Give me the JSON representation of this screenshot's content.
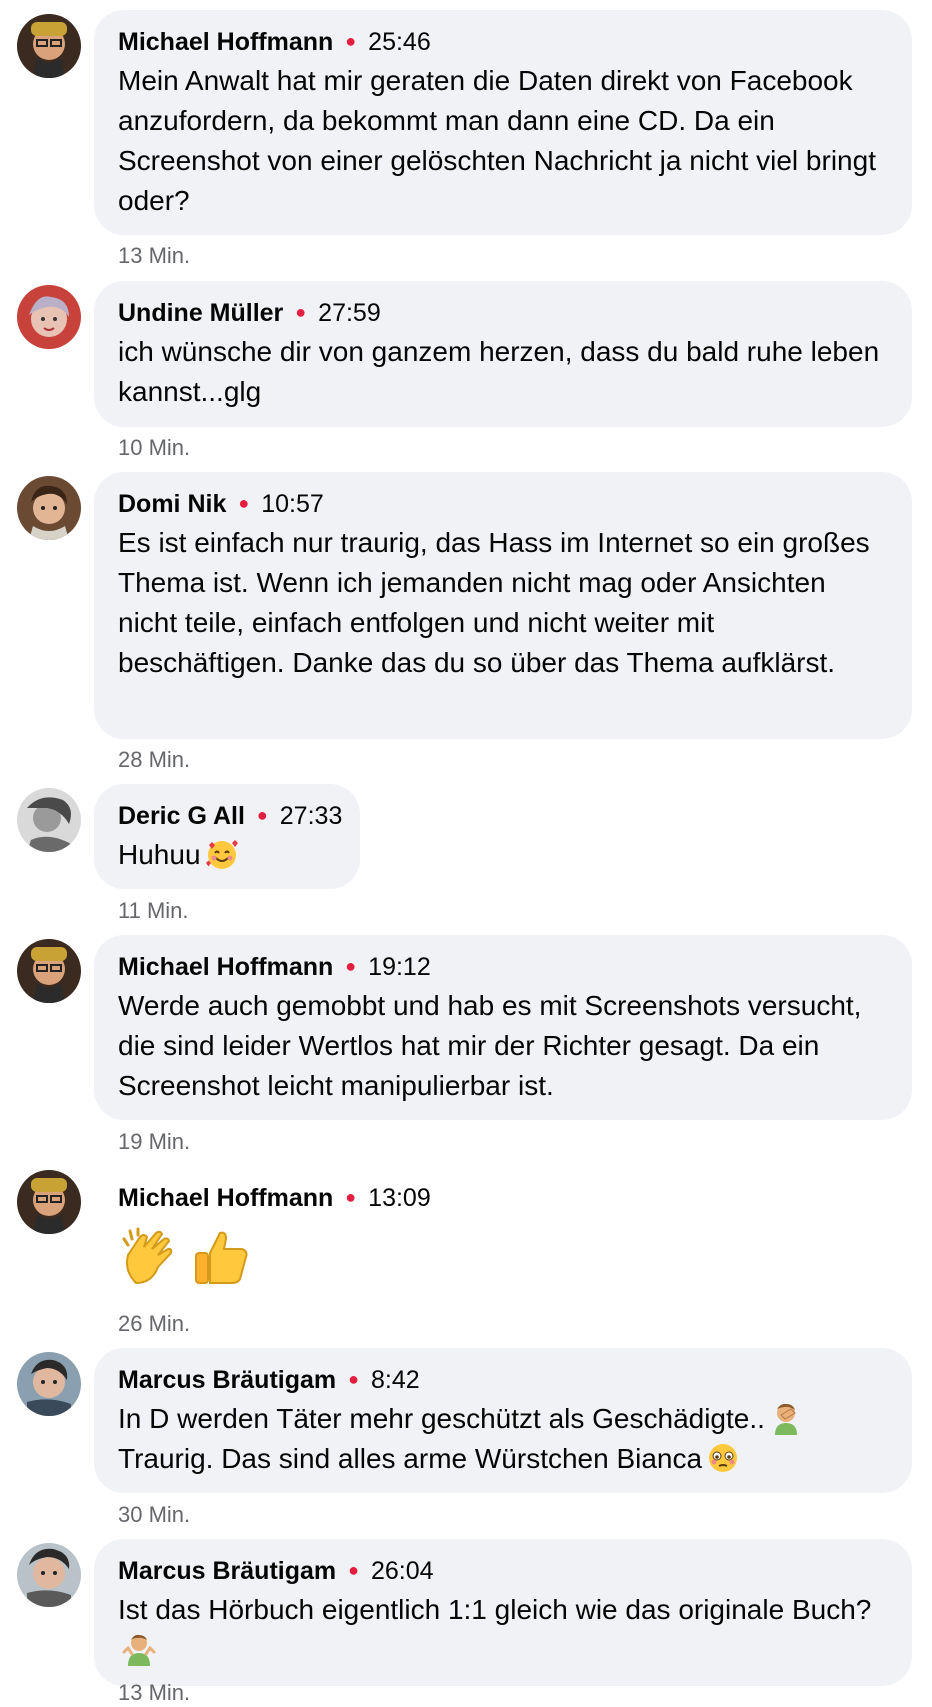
{
  "comments": [
    {
      "author": "Michael Hoffmann",
      "time": "25:46",
      "text": "Mein Anwalt hat mir geraten die Daten direkt von Facebook anzufordern, da bekommt man dann eine CD. Da ein Screenshot von einer gelöschten Nachricht ja nicht viel bringt oder?",
      "ago": "13 Min."
    },
    {
      "author": "Undine Müller",
      "time": "27:59",
      "text": "ich wünsche dir von ganzem herzen, dass du bald ruhe leben kannst...glg",
      "ago": "10 Min."
    },
    {
      "author": "Domi Nik",
      "time": "10:57",
      "text": "Es ist einfach nur traurig, das Hass im Internet so ein großes Thema ist. Wenn ich jemanden nicht mag oder Ansichten nicht teile, einfach entfolgen und nicht weiter mit beschäftigen. Danke das du so über das Thema aufklärst.",
      "ago": "28 Min."
    },
    {
      "author": "Deric G All",
      "time": "27:33",
      "text": "Huhuu",
      "emoji": "smiling-face-with-hearts",
      "ago": "11 Min."
    },
    {
      "author": "Michael Hoffmann",
      "time": "19:12",
      "text": "Werde auch gemobbt und hab es mit Screenshots versucht, die sind leider Wertlos hat mir der Richter gesagt. Da ein Screenshot leicht manipulierbar ist.",
      "ago": "19 Min."
    },
    {
      "author": "Michael Hoffmann",
      "time": "13:09",
      "emojis": [
        "clapping-hands",
        "thumbs-up"
      ],
      "ago": "26 Min."
    },
    {
      "author": "Marcus Bräutigam",
      "time": "8:42",
      "line1": "In D werden Täter mehr geschützt als Geschädigte..",
      "line2": "Traurig. Das sind alles arme Würstchen Bianca",
      "emoji1": "man-facepalming",
      "emoji2": "flushed-face",
      "ago": "30 Min."
    },
    {
      "author": "Marcus Bräutigam",
      "time": "26:04",
      "text": "Ist das Hörbuch eigentlich 1:1 gleich wie das originale Buch?",
      "emoji": "man-shrugging",
      "ago": "13 Min."
    }
  ],
  "colors": {
    "bubble": "#f0f2f5",
    "dot": "#e41e3f",
    "meta": "#65676b"
  }
}
